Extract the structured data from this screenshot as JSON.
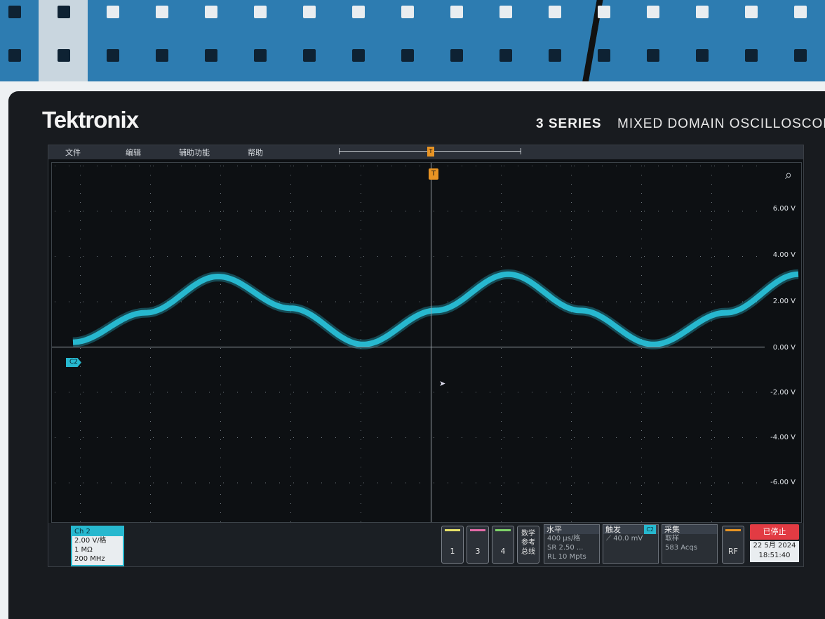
{
  "device": {
    "brand": "Tektronix",
    "series": "3 SERIES",
    "subtitle": "MIXED DOMAIN OSCILLOSCOPE"
  },
  "menu": [
    "文件",
    "编辑",
    "辅助功能",
    "帮助"
  ],
  "display": {
    "trigger_label": "T",
    "voltage_labels": [
      "6.00 V",
      "4.00 V",
      "2.00 V",
      "0.00 V",
      "-2.00 V",
      "-4.00 V",
      "-6.00 V"
    ],
    "channel_marker": "C2",
    "trace_color": "#27b8cf",
    "trigger_color": "#e89424"
  },
  "channel": {
    "name": "Ch 2",
    "scale": "2.00 V/格",
    "impedance": "1 MΩ",
    "bandwidth": "200 MHz"
  },
  "buttons": {
    "ch1": "1",
    "ch3": "3",
    "ch4": "4",
    "math": "数学\n参考\n总线",
    "rf": "RF"
  },
  "horizontal": {
    "title": "水平",
    "scale": "400 μs/格",
    "sample_rate": "SR 2.50 ...",
    "record_length": "RL 10 Mpts"
  },
  "trigger": {
    "title": "触发",
    "badge": "C2",
    "level": "40.0 mV"
  },
  "acquisition": {
    "title": "采集",
    "mode": "取样",
    "count": "583 Acqs"
  },
  "status": {
    "state": "已停止",
    "date": "22 5月 2024",
    "time": "18:51:40"
  },
  "chart_data": {
    "type": "line",
    "xlabel": "",
    "ylabel": "",
    "ylim": [
      -8,
      8
    ],
    "x": [
      0,
      0.4,
      0.8,
      1.2,
      1.6,
      2.0,
      2.4,
      2.8,
      3.2,
      3.6,
      4.0
    ],
    "series": [
      {
        "name": "C2",
        "values": [
          0.2,
          1.5,
          3.1,
          1.7,
          0.1,
          1.6,
          3.2,
          1.6,
          0.1,
          1.5,
          3.2
        ]
      }
    ]
  }
}
